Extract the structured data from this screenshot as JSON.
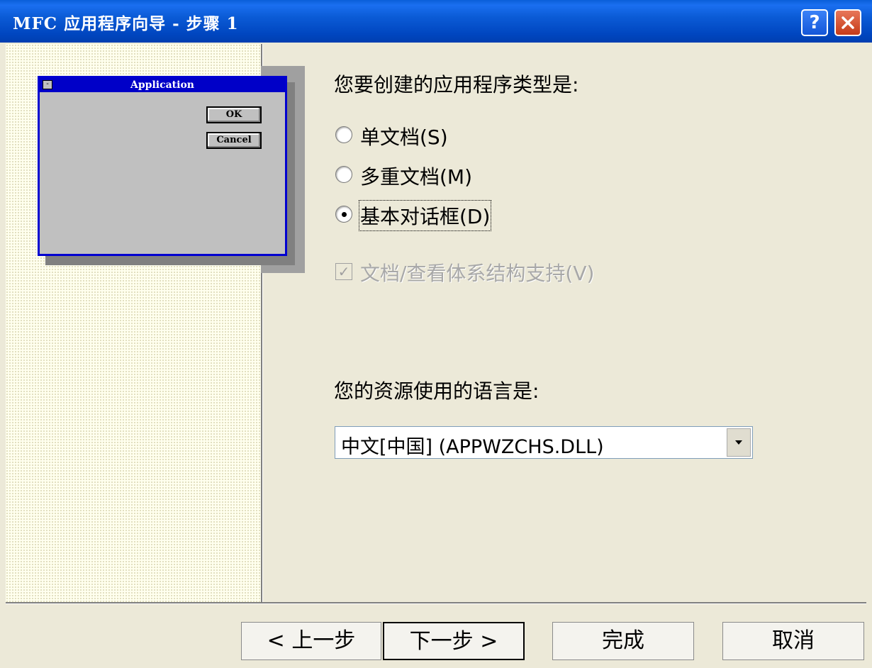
{
  "window": {
    "title": "MFC 应用程序向导 - 步骤 1"
  },
  "title_buttons": {
    "help": "?",
    "close": "✕"
  },
  "illustration": {
    "title": "Application",
    "ok": "OK",
    "cancel": "Cancel",
    "sys": "-"
  },
  "app_type": {
    "prompt": "您要创建的应用程序类型是:",
    "options": [
      {
        "label": "单文档(S)",
        "selected": false
      },
      {
        "label": "多重文档(M)",
        "selected": false
      },
      {
        "label": "基本对话框(D)",
        "selected": true
      }
    ]
  },
  "docview": {
    "label": "文档/查看体系结构支持(V)",
    "checked": true,
    "enabled": false
  },
  "language": {
    "prompt": "您的资源使用的语言是:",
    "selected": "中文[中国] (APPWZCHS.DLL)"
  },
  "footer": {
    "back": "< 上一步",
    "next": "下一步 >",
    "finish": "完成",
    "cancel": "取消"
  }
}
